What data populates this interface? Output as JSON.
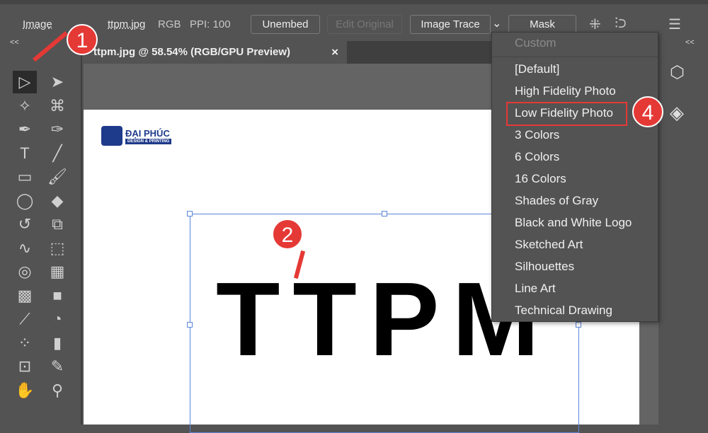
{
  "toolbar": {
    "mode": "Image",
    "filename": "ttpm.jpg",
    "color_mode": "RGB",
    "ppi": "PPI: 100",
    "unembed": "Unembed",
    "edit_original": "Edit Original",
    "image_trace": "Image Trace",
    "mask": "Mask"
  },
  "document": {
    "tab_title": "ttpm.jpg @ 58.54% (RGB/GPU Preview)",
    "close": "×",
    "artwork_text": "TTPM",
    "logo_name": "ĐẠI PHÚC",
    "logo_tagline": "DESIGN & PRINTING"
  },
  "panels": {
    "collapse": "<<"
  },
  "trace_menu": {
    "header": "Custom",
    "items": [
      "[Default]",
      "High Fidelity Photo",
      "Low Fidelity Photo",
      "3 Colors",
      "6 Colors",
      "16 Colors",
      "Shades of Gray",
      "Black and White Logo",
      "Sketched Art",
      "Silhouettes",
      "Line Art",
      "Technical Drawing"
    ],
    "highlighted": "Low Fidelity Photo"
  },
  "annotations": {
    "step1": "1",
    "step2": "2",
    "step4": "4",
    "color": "#e53935"
  },
  "tools": [
    "selection",
    "direct-selection",
    "magic-wand",
    "lasso",
    "pen",
    "curvature",
    "type",
    "line",
    "rectangle",
    "paintbrush",
    "shaper",
    "eraser",
    "rotate",
    "scale",
    "warp",
    "free-transform",
    "shape-builder",
    "perspective-grid",
    "mesh",
    "gradient",
    "eyedropper",
    "blend",
    "symbol-sprayer",
    "column-graph",
    "artboard",
    "slice",
    "hand",
    "zoom"
  ]
}
